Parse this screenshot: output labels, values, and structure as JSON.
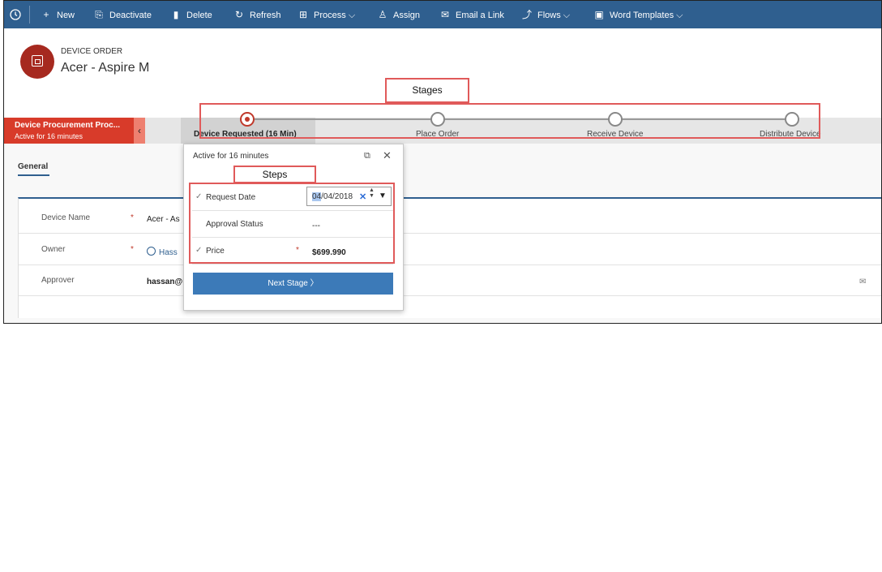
{
  "commandbar": {
    "items": [
      {
        "label": "New",
        "icon": "plus-icon"
      },
      {
        "label": "Deactivate",
        "icon": "deactivate-icon"
      },
      {
        "label": "Delete",
        "icon": "trash-icon"
      },
      {
        "label": "Refresh",
        "icon": "refresh-icon"
      },
      {
        "label": "Process",
        "icon": "process-icon",
        "has_menu": true
      },
      {
        "label": "Assign",
        "icon": "assign-icon"
      },
      {
        "label": "Email a Link",
        "icon": "email-icon"
      },
      {
        "label": "Flows",
        "icon": "flows-icon",
        "has_menu": true
      },
      {
        "label": "Word Templates",
        "icon": "word-icon",
        "has_menu": true
      }
    ],
    "chevron": "⌵"
  },
  "header": {
    "entity_type": "DEVICE ORDER",
    "record_name": "Acer - Aspire M"
  },
  "process": {
    "name": "Device Procurement Proc...",
    "status": "Active for 16 minutes",
    "collapse_glyph": "‹",
    "stages": [
      {
        "label": "Device Requested  (16 Min)",
        "active": true
      },
      {
        "label": "Place Order",
        "active": false
      },
      {
        "label": "Receive Device",
        "active": false
      },
      {
        "label": "Distribute Device",
        "active": false
      }
    ]
  },
  "annotations": {
    "stages": "Stages",
    "steps": "Steps"
  },
  "form": {
    "tab": "General",
    "fields": [
      {
        "label": "Device Name",
        "required": "*",
        "value": "Acer - As"
      },
      {
        "label": "Owner",
        "required": "*",
        "value": "Hass"
      },
      {
        "label": "Approver",
        "required": "",
        "value": "hassan@"
      }
    ]
  },
  "flyout": {
    "title": "Active for 16 minutes",
    "popout_glyph": "⧉",
    "close_glyph": "✕",
    "steps": [
      {
        "check": "✓",
        "label": "Request Date",
        "required": "",
        "value": ""
      },
      {
        "check": "",
        "label": "Approval Status",
        "required": "",
        "value": "---"
      },
      {
        "check": "✓",
        "label": "Price",
        "required": "*",
        "value": "$699.990"
      }
    ],
    "date": {
      "month": "04",
      "rest": "/04/2018",
      "clear": "✕",
      "spin_up": "▲",
      "spin_down": "▼",
      "drop": "▼"
    },
    "next_button": "Next Stage",
    "next_glyph": "〉"
  }
}
